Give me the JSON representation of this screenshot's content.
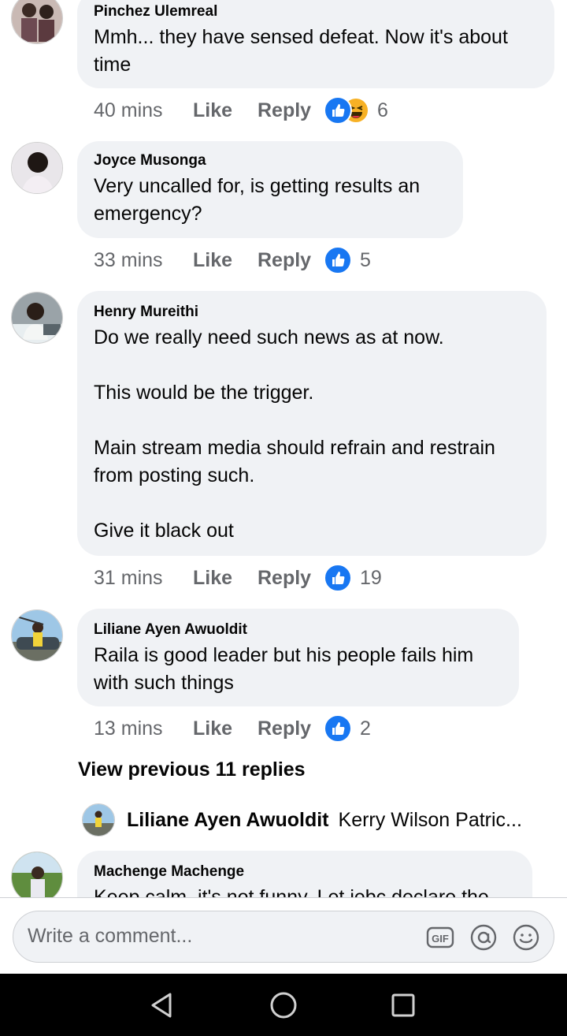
{
  "comments": [
    {
      "author": "Pinchez Ulemreal",
      "text": "Mmh... they have sensed defeat. Now it's about\ntime",
      "time": "40 mins",
      "like": "Like",
      "reply": "Reply",
      "reactions": [
        "like-icon",
        "haha-icon"
      ],
      "reaction_count": "6"
    },
    {
      "author": "Joyce Musonga",
      "text": "Very uncalled for, is getting results an\nemergency?",
      "time": "33 mins",
      "like": "Like",
      "reply": "Reply",
      "reactions": [
        "like-icon"
      ],
      "reaction_count": "5"
    },
    {
      "author": "Henry Mureithi",
      "text": "Do we really need such news as at now.\n\nThis would be the trigger.\n\nMain stream media should refrain and restrain\nfrom posting such.\n\nGive it black out",
      "time": "31 mins",
      "like": "Like",
      "reply": "Reply",
      "reactions": [
        "like-icon"
      ],
      "reaction_count": "19"
    },
    {
      "author": "Liliane Ayen Awuoldit",
      "text": "Raila is good leader but his people fails him\nwith such things",
      "time": "13 mins",
      "like": "Like",
      "reply": "Reply",
      "reactions": [
        "like-icon"
      ],
      "reaction_count": "2"
    },
    {
      "author": "Machenge Machenge",
      "text": "Keep calm, it's not funny. Let iebc declare the"
    }
  ],
  "view_previous": "View previous 11 replies",
  "reply_preview": {
    "name": "Liliane Ayen Awuoldit",
    "text": "Kerry Wilson Patric..."
  },
  "composer": {
    "placeholder": "Write a comment...",
    "icons": [
      "gif-icon",
      "mention-icon",
      "emoji-icon"
    ]
  },
  "navbar": {
    "icons": [
      "back-icon",
      "home-icon",
      "recents-icon"
    ]
  },
  "colors": {
    "bubble": "#f0f2f5",
    "like_blue": "#1877f2",
    "meta_gray": "#65676b",
    "haha_yellow": "#f7b125"
  }
}
